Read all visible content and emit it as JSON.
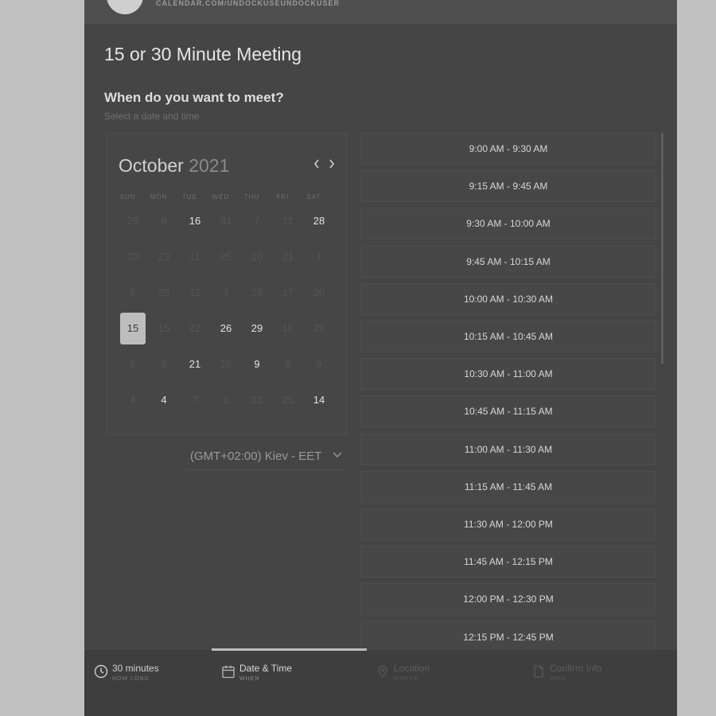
{
  "header": {
    "url": "CALENDAR.COM/UNDOCKUSEUNDOCKUSER"
  },
  "page": {
    "title": "15 or 30 Minute Meeting",
    "question": "When do you want to meet?",
    "helper": "Select a date and time"
  },
  "calendar": {
    "month": "October",
    "year": "2021",
    "weekdays": [
      "SUN",
      "MON",
      "TUE",
      "WED",
      "THU",
      "FRI",
      "SAT"
    ],
    "weeks": [
      [
        {
          "d": "29",
          "s": "dim"
        },
        {
          "d": "9",
          "s": "dim"
        },
        {
          "d": "16",
          "s": "avail"
        },
        {
          "d": "31",
          "s": "dim"
        },
        {
          "d": "7",
          "s": "dim"
        },
        {
          "d": "11",
          "s": "dim"
        },
        {
          "d": "28",
          "s": "avail"
        }
      ],
      [
        {
          "d": "20",
          "s": "dim"
        },
        {
          "d": "23",
          "s": "dim"
        },
        {
          "d": "11",
          "s": "dim"
        },
        {
          "d": "25",
          "s": "dim"
        },
        {
          "d": "10",
          "s": "dim"
        },
        {
          "d": "21",
          "s": "dim"
        },
        {
          "d": "1",
          "s": "dim"
        }
      ],
      [
        {
          "d": "8",
          "s": "dim"
        },
        {
          "d": "28",
          "s": "dim"
        },
        {
          "d": "12",
          "s": "dim"
        },
        {
          "d": "3",
          "s": "dim"
        },
        {
          "d": "29",
          "s": "dim"
        },
        {
          "d": "17",
          "s": "dim"
        },
        {
          "d": "20",
          "s": "dim"
        }
      ],
      [
        {
          "d": "15",
          "s": "selected"
        },
        {
          "d": "15",
          "s": "dim"
        },
        {
          "d": "22",
          "s": "dim"
        },
        {
          "d": "26",
          "s": "avail"
        },
        {
          "d": "29",
          "s": "avail"
        },
        {
          "d": "10",
          "s": "dim"
        },
        {
          "d": "25",
          "s": "dim"
        }
      ],
      [
        {
          "d": "6",
          "s": "dim"
        },
        {
          "d": "3",
          "s": "dim"
        },
        {
          "d": "21",
          "s": "avail"
        },
        {
          "d": "28",
          "s": "dim"
        },
        {
          "d": "9",
          "s": "avail"
        },
        {
          "d": "6",
          "s": "dim"
        },
        {
          "d": "9",
          "s": "dim"
        }
      ],
      [
        {
          "d": "4",
          "s": "dim"
        },
        {
          "d": "4",
          "s": "avail"
        },
        {
          "d": "7",
          "s": "dim"
        },
        {
          "d": "1",
          "s": "dim"
        },
        {
          "d": "23",
          "s": "dim"
        },
        {
          "d": "25",
          "s": "dim"
        },
        {
          "d": "14",
          "s": "avail"
        }
      ]
    ]
  },
  "timezone": {
    "label": "(GMT+02:00) Kiev - EET"
  },
  "slots": [
    "9:00 AM - 9:30 AM",
    "9:15 AM - 9:45 AM",
    "9:30 AM - 10:00 AM",
    "9:45 AM - 10:15 AM",
    "10:00 AM - 10:30 AM",
    "10:15 AM - 10:45 AM",
    "10:30 AM - 11:00 AM",
    "10:45 AM - 11:15 AM",
    "11:00 AM - 11:30 AM",
    "11:15 AM - 11:45 AM",
    "11:30 AM - 12:00 PM",
    "11:45 AM - 12:15 PM",
    "12:00 PM - 12:30 PM",
    "12:15 PM - 12:45 PM"
  ],
  "steps": [
    {
      "label": "30 minutes",
      "sub": "HOW LONG",
      "state": "done",
      "icon": "clock-icon"
    },
    {
      "label": "Date & Time",
      "sub": "WHEN",
      "state": "active",
      "icon": "calendar-icon"
    },
    {
      "label": "Location",
      "sub": "WHERE",
      "state": "future",
      "icon": "location-pin-icon"
    },
    {
      "label": "Confirm Info",
      "sub": "WHO",
      "state": "future",
      "icon": "document-icon"
    }
  ]
}
